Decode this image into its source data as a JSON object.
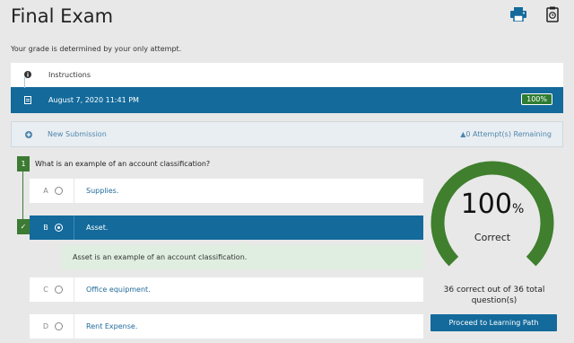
{
  "page": {
    "title": "Final Exam",
    "grade_note": "Your grade is determined by your only attempt."
  },
  "header_icons": [
    "printer-icon",
    "clipboard-clock-icon"
  ],
  "attempts_panel": {
    "instructions_label": "Instructions",
    "attempt_date": "August 7, 2020 11:41 PM",
    "attempt_score": "100%"
  },
  "new_submission": {
    "label": "New Submission",
    "remaining": "0 Attempt(s) Remaining"
  },
  "question": {
    "number": "1",
    "text": "What is an example of an account classification?",
    "choices": [
      {
        "letter": "A",
        "text": "Supplies.",
        "selected": false
      },
      {
        "letter": "B",
        "text": "Asset.",
        "selected": true
      },
      {
        "letter": "C",
        "text": "Office equipment.",
        "selected": false
      },
      {
        "letter": "D",
        "text": "Rent Expense.",
        "selected": false
      }
    ],
    "correct_mark": "✓",
    "feedback": "Asset is an example of an account classification."
  },
  "score": {
    "value": "100",
    "symbol": "%",
    "label": "Correct",
    "fraction": 1.0,
    "summary": "36 correct out of 36 total question(s)",
    "button_label": "Proceed to Learning Path"
  },
  "colors": {
    "primary_blue": "#136a9b",
    "success_green": "#3d7a33",
    "gauge_green": "#3f7f2d",
    "feedback_bg": "#dfeee0",
    "page_bg": "#e8e8e8"
  }
}
